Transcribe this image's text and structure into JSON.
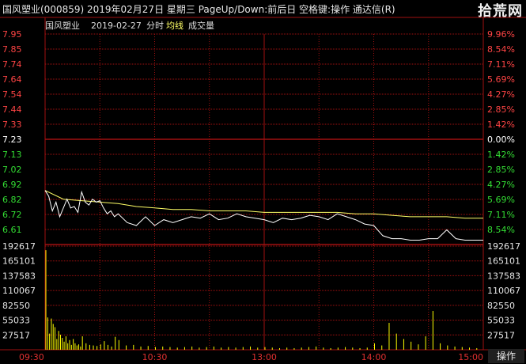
{
  "window": {
    "title": "国风塑业(000859)  2019年02月27日  星期三  PageUp/Down:前后日  空格键:操作  通达信(R)",
    "watermark": "拾荒网"
  },
  "legend": {
    "stock": "国风塑业",
    "date": "2019-02-27",
    "mode": "分时",
    "avg_line": "均线",
    "volume": "成交量"
  },
  "bottom": {
    "operate_button": "操作"
  },
  "colors": {
    "grid": "#a01010",
    "price_line": "#ffffff",
    "avg_line": "#ffff66",
    "axis_up": "#ff4444",
    "axis_down": "#33dd33",
    "volume": "#ffff00"
  },
  "chart_data": [
    {
      "type": "line",
      "title": "",
      "x_ticks": [
        "09:30",
        "10:30",
        "13:00",
        "14:00",
        "15:00"
      ],
      "price_ticks": [
        "7.95",
        "7.85",
        "7.74",
        "7.64",
        "7.54",
        "7.44",
        "7.33",
        "7.23",
        "7.13",
        "7.02",
        "6.92",
        "6.82",
        "6.72",
        "6.61"
      ],
      "pct_ticks": [
        "9.96%",
        "8.54%",
        "7.11%",
        "5.69%",
        "4.27%",
        "2.85%",
        "1.42%",
        "0.00%",
        "1.42%",
        "2.85%",
        "4.27%",
        "5.69%",
        "7.11%",
        "8.54%"
      ],
      "ylim": [
        6.51,
        7.95
      ],
      "prev_close": 7.23,
      "series": [
        {
          "name": "",
          "x": [
            0,
            2,
            4,
            6,
            8,
            10,
            12,
            14,
            16,
            18,
            20,
            22,
            24,
            26,
            28,
            30,
            32,
            34,
            36,
            38,
            40,
            45,
            50,
            55,
            60,
            65,
            70,
            75,
            80,
            85,
            90,
            95,
            100,
            105,
            110,
            115,
            120,
            125,
            130,
            135,
            140,
            145,
            150,
            155,
            160,
            165,
            170,
            175,
            180,
            185,
            190,
            195,
            200,
            205,
            210,
            215,
            220,
            225,
            230,
            235,
            240
          ],
          "values": [
            6.88,
            6.84,
            6.74,
            6.8,
            6.7,
            6.76,
            6.82,
            6.76,
            6.77,
            6.73,
            6.87,
            6.8,
            6.78,
            6.82,
            6.8,
            6.81,
            6.76,
            6.72,
            6.74,
            6.7,
            6.72,
            6.66,
            6.64,
            6.7,
            6.64,
            6.68,
            6.66,
            6.68,
            6.7,
            6.69,
            6.72,
            6.68,
            6.69,
            6.72,
            6.7,
            6.69,
            6.68,
            6.66,
            6.69,
            6.68,
            6.69,
            6.71,
            6.7,
            6.68,
            6.72,
            6.7,
            6.68,
            6.65,
            6.64,
            6.57,
            6.55,
            6.55,
            6.54,
            6.54,
            6.55,
            6.55,
            6.61,
            6.55,
            6.54,
            6.54,
            6.54
          ]
        },
        {
          "name": "均线",
          "x": [
            0,
            10,
            20,
            30,
            40,
            50,
            60,
            70,
            80,
            90,
            100,
            110,
            120,
            130,
            140,
            150,
            160,
            170,
            180,
            190,
            200,
            210,
            220,
            230,
            240
          ],
          "values": [
            6.88,
            6.82,
            6.81,
            6.8,
            6.79,
            6.77,
            6.76,
            6.75,
            6.75,
            6.74,
            6.74,
            6.74,
            6.73,
            6.73,
            6.73,
            6.73,
            6.73,
            6.72,
            6.72,
            6.71,
            6.7,
            6.7,
            6.7,
            6.69,
            6.69
          ]
        }
      ]
    },
    {
      "type": "bar",
      "title": "",
      "ylim": [
        0,
        192617
      ],
      "y_ticks": [
        "192617",
        "165101",
        "137583",
        "110067",
        "82550",
        "55033",
        "27517"
      ],
      "series": [
        {
          "name": "成交量",
          "x": [
            0,
            1,
            2,
            3,
            4,
            5,
            6,
            7,
            8,
            9,
            10,
            11,
            12,
            13,
            14,
            15,
            16,
            17,
            18,
            19,
            20,
            22,
            24,
            26,
            28,
            30,
            32,
            34,
            36,
            38,
            40,
            44,
            48,
            52,
            56,
            60,
            64,
            68,
            72,
            76,
            80,
            84,
            88,
            92,
            96,
            100,
            104,
            108,
            112,
            116,
            120,
            124,
            128,
            132,
            136,
            140,
            144,
            148,
            152,
            156,
            160,
            164,
            168,
            172,
            176,
            180,
            184,
            188,
            192,
            196,
            200,
            204,
            208,
            212,
            216,
            220,
            224,
            228,
            232,
            236
          ],
          "values": [
            185000,
            60000,
            30000,
            58000,
            48000,
            42000,
            20000,
            35000,
            28000,
            22000,
            15000,
            25000,
            12000,
            18000,
            9000,
            20000,
            12000,
            8000,
            10000,
            6000,
            25000,
            12000,
            9000,
            8000,
            7000,
            10000,
            16000,
            9000,
            6000,
            24000,
            18000,
            8000,
            9000,
            6000,
            7000,
            5000,
            6000,
            5000,
            4000,
            5000,
            6000,
            4000,
            5000,
            6000,
            4000,
            5000,
            4000,
            5000,
            6000,
            4000,
            5000,
            4000,
            3000,
            4000,
            3000,
            4000,
            5000,
            6000,
            4000,
            3000,
            4000,
            5000,
            4000,
            3000,
            4000,
            12000,
            8000,
            50000,
            30000,
            20000,
            15000,
            10000,
            25000,
            72000,
            12000,
            8000,
            6000,
            5000,
            4000,
            3000
          ]
        }
      ]
    }
  ]
}
